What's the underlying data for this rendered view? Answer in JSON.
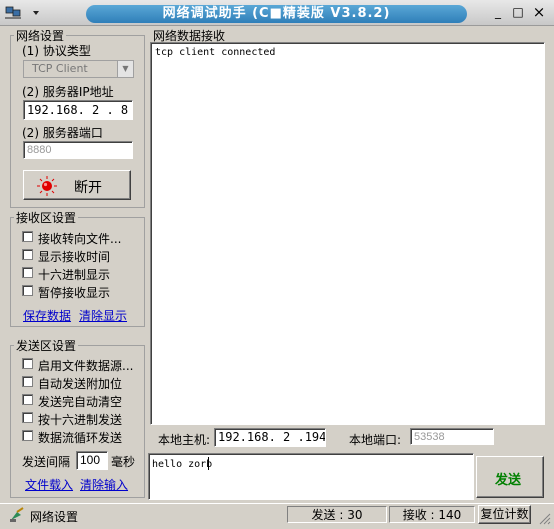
{
  "window": {
    "title": "网络调试助手 (C■精装版 V3.8.2)",
    "minimize": "_",
    "maximize": "□",
    "close": "×"
  },
  "net_settings": {
    "legend": "网络设置",
    "protocol_label": "(1) 协议类型",
    "protocol_value": "TCP Client",
    "ip_label": "(2) 服务器IP地址",
    "ip_value": "192.168. 2 . 8",
    "port_label": "(2) 服务器端口",
    "port_value": "8880",
    "connect_button": "断开"
  },
  "recv_settings": {
    "legend": "接收区设置",
    "options": [
      {
        "label": "接收转向文件..."
      },
      {
        "label": "显示接收时间"
      },
      {
        "label": "十六进制显示"
      },
      {
        "label": "暂停接收显示"
      }
    ],
    "save_link": "保存数据",
    "clear_link": "清除显示"
  },
  "send_settings": {
    "legend": "发送区设置",
    "options": [
      {
        "label": "启用文件数据源..."
      },
      {
        "label": "自动发送附加位"
      },
      {
        "label": "发送完自动清空"
      },
      {
        "label": "按十六进制发送"
      },
      {
        "label": "数据流循环发送"
      }
    ],
    "interval_label": "发送间隔",
    "interval_value": "100",
    "interval_unit": "毫秒",
    "load_file_link": "文件载入",
    "clear_input_link": "清除输入"
  },
  "receive_area": {
    "legend": "网络数据接收",
    "text": "tcp client connected"
  },
  "local": {
    "host_label": "本地主机:",
    "host_value": "192.168. 2 .194",
    "port_label": "本地端口:",
    "port_value": "53538"
  },
  "send_area": {
    "text": "hello zorb",
    "send_button": "发送"
  },
  "status": {
    "mode": "网络设置",
    "sent": "发送 : 30",
    "received": "接收 : 140",
    "reset_button": "复位计数"
  },
  "colors": {
    "title_blue": "#2f7fb9",
    "indicator_red": "#e00000",
    "send_green": "#008000"
  }
}
